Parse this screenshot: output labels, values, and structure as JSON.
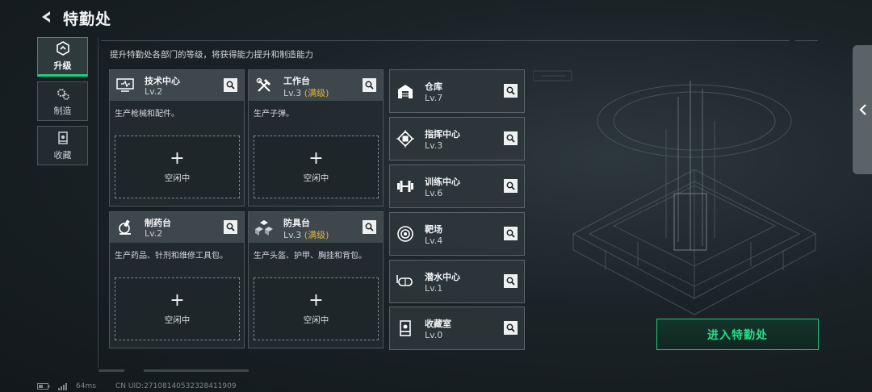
{
  "header": {
    "title": "特勤处"
  },
  "subtitle": "提升特勤处各部门的等级，将获得能力提升和制造能力",
  "side_nav": {
    "items": [
      {
        "label": "升级",
        "icon": "upgrade-icon",
        "active": true
      },
      {
        "label": "制造",
        "icon": "gears-icon",
        "active": false
      },
      {
        "label": "收藏",
        "icon": "collection-icon",
        "active": false
      }
    ]
  },
  "big_cards": [
    {
      "name": "技术中心",
      "level": "Lv.2",
      "max": "",
      "desc": "生产枪械和配件。",
      "slot": "空闲中",
      "icon": "monitor-icon"
    },
    {
      "name": "工作台",
      "level": "Lv.3",
      "max": "(满级)",
      "desc": "生产子弹。",
      "slot": "空闲中",
      "icon": "tools-icon"
    },
    {
      "name": "制药台",
      "level": "Lv.2",
      "max": "",
      "desc": "生产药品、针剂和维修工具包。",
      "slot": "空闲中",
      "icon": "microscope-icon"
    },
    {
      "name": "防具台",
      "level": "Lv.3",
      "max": "(满级)",
      "desc": "生产头盔、护甲、胸挂和背包。",
      "slot": "空闲中",
      "icon": "cubes-icon"
    }
  ],
  "small_cards": [
    {
      "name": "仓库",
      "level": "Lv.7",
      "icon": "warehouse-icon"
    },
    {
      "name": "指挥中心",
      "level": "Lv.3",
      "icon": "chip-icon"
    },
    {
      "name": "训练中心",
      "level": "Lv.6",
      "icon": "dumbbell-icon"
    },
    {
      "name": "靶场",
      "level": "Lv.4",
      "icon": "target-icon"
    },
    {
      "name": "潜水中心",
      "level": "Lv.1",
      "icon": "diving-mask-icon"
    },
    {
      "name": "收藏室",
      "level": "Lv.0",
      "icon": "display-case-icon"
    }
  ],
  "enter_button": "进入特勤处",
  "status": {
    "ping": "64ms",
    "uid": "CN UID:271081405323284119​09"
  },
  "colors": {
    "accent": "#19d480",
    "max_level": "#e0b23e"
  }
}
